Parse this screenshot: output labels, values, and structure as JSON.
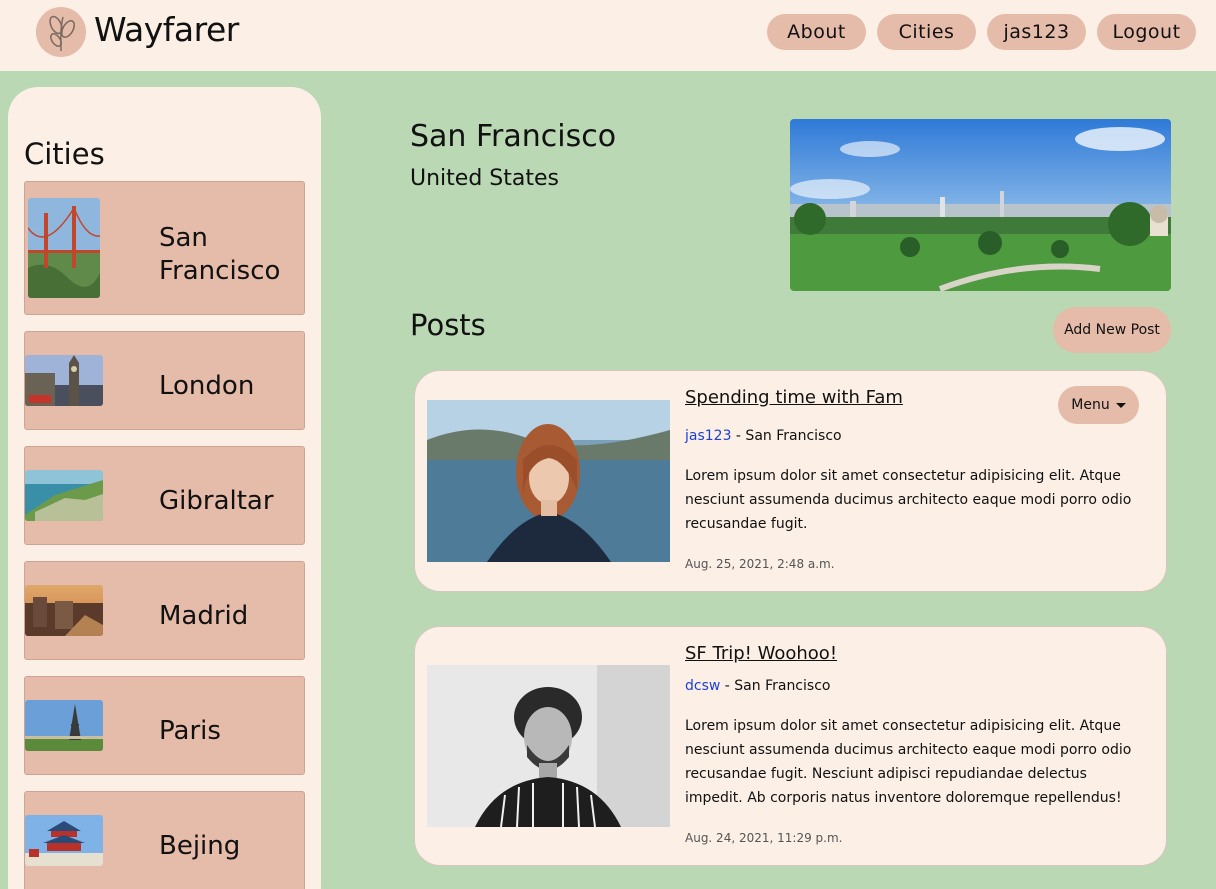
{
  "header": {
    "brand": "Wayfarer",
    "nav": [
      "About",
      "Cities",
      "jas123",
      "Logout"
    ]
  },
  "sidebar": {
    "title": "Cities",
    "cities": [
      {
        "name": "San Francisco",
        "thumb": "golden-gate-bridge"
      },
      {
        "name": "London",
        "thumb": "big-ben"
      },
      {
        "name": "Gibraltar",
        "thumb": "rock-of-gibraltar"
      },
      {
        "name": "Madrid",
        "thumb": "madrid-skyline"
      },
      {
        "name": "Paris",
        "thumb": "eiffel-tower"
      },
      {
        "name": "Bejing",
        "thumb": "temple-of-heaven"
      }
    ]
  },
  "main": {
    "city": "San Francisco",
    "country": "United States",
    "posts_title": "Posts",
    "add_post_label": "Add New Post",
    "posts": [
      {
        "title": "Spending time with Fam",
        "author": "jas123",
        "location": " - San Francisco",
        "body": "Lorem ipsum dolor sit amet consectetur adipisicing elit. Atque nesciunt assumenda ducimus architecto eaque modi porro odio recusandae fugit.",
        "date": "Aug. 25, 2021, 2:48 a.m.",
        "menu_label": "Menu"
      },
      {
        "title": "SF Trip! Woohoo!",
        "author": "dcsw",
        "location": " - San Francisco",
        "body": "Lorem ipsum dolor sit amet consectetur adipisicing elit. Atque nesciunt assumenda ducimus architecto eaque modi porro odio recusandae fugit. Nesciunt adipisci repudiandae delectus impedit. Ab corporis natus inventore doloremque repellendus!",
        "date": "Aug. 24, 2021, 11:29 p.m."
      }
    ]
  },
  "colors": {
    "background": "#b9d8b3",
    "panel": "#fbefe6",
    "accent": "#e5bba9",
    "link": "#1c3fd6"
  }
}
